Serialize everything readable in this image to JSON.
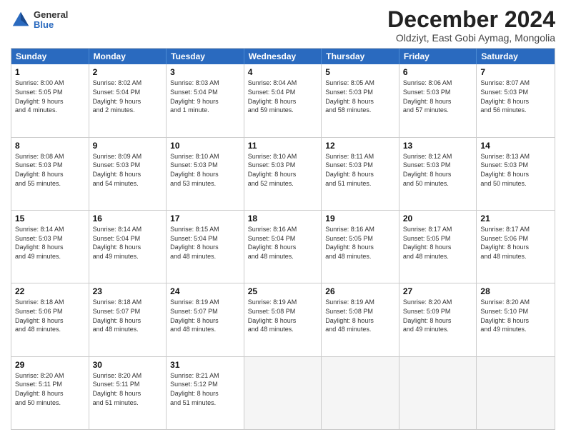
{
  "logo": {
    "general": "General",
    "blue": "Blue"
  },
  "title": "December 2024",
  "subtitle": "Oldziyt, East Gobi Aymag, Mongolia",
  "header_days": [
    "Sunday",
    "Monday",
    "Tuesday",
    "Wednesday",
    "Thursday",
    "Friday",
    "Saturday"
  ],
  "weeks": [
    [
      {
        "day": "1",
        "lines": [
          "Sunrise: 8:00 AM",
          "Sunset: 5:05 PM",
          "Daylight: 9 hours",
          "and 4 minutes."
        ]
      },
      {
        "day": "2",
        "lines": [
          "Sunrise: 8:02 AM",
          "Sunset: 5:04 PM",
          "Daylight: 9 hours",
          "and 2 minutes."
        ]
      },
      {
        "day": "3",
        "lines": [
          "Sunrise: 8:03 AM",
          "Sunset: 5:04 PM",
          "Daylight: 9 hours",
          "and 1 minute."
        ]
      },
      {
        "day": "4",
        "lines": [
          "Sunrise: 8:04 AM",
          "Sunset: 5:04 PM",
          "Daylight: 8 hours",
          "and 59 minutes."
        ]
      },
      {
        "day": "5",
        "lines": [
          "Sunrise: 8:05 AM",
          "Sunset: 5:03 PM",
          "Daylight: 8 hours",
          "and 58 minutes."
        ]
      },
      {
        "day": "6",
        "lines": [
          "Sunrise: 8:06 AM",
          "Sunset: 5:03 PM",
          "Daylight: 8 hours",
          "and 57 minutes."
        ]
      },
      {
        "day": "7",
        "lines": [
          "Sunrise: 8:07 AM",
          "Sunset: 5:03 PM",
          "Daylight: 8 hours",
          "and 56 minutes."
        ]
      }
    ],
    [
      {
        "day": "8",
        "lines": [
          "Sunrise: 8:08 AM",
          "Sunset: 5:03 PM",
          "Daylight: 8 hours",
          "and 55 minutes."
        ]
      },
      {
        "day": "9",
        "lines": [
          "Sunrise: 8:09 AM",
          "Sunset: 5:03 PM",
          "Daylight: 8 hours",
          "and 54 minutes."
        ]
      },
      {
        "day": "10",
        "lines": [
          "Sunrise: 8:10 AM",
          "Sunset: 5:03 PM",
          "Daylight: 8 hours",
          "and 53 minutes."
        ]
      },
      {
        "day": "11",
        "lines": [
          "Sunrise: 8:10 AM",
          "Sunset: 5:03 PM",
          "Daylight: 8 hours",
          "and 52 minutes."
        ]
      },
      {
        "day": "12",
        "lines": [
          "Sunrise: 8:11 AM",
          "Sunset: 5:03 PM",
          "Daylight: 8 hours",
          "and 51 minutes."
        ]
      },
      {
        "day": "13",
        "lines": [
          "Sunrise: 8:12 AM",
          "Sunset: 5:03 PM",
          "Daylight: 8 hours",
          "and 50 minutes."
        ]
      },
      {
        "day": "14",
        "lines": [
          "Sunrise: 8:13 AM",
          "Sunset: 5:03 PM",
          "Daylight: 8 hours",
          "and 50 minutes."
        ]
      }
    ],
    [
      {
        "day": "15",
        "lines": [
          "Sunrise: 8:14 AM",
          "Sunset: 5:03 PM",
          "Daylight: 8 hours",
          "and 49 minutes."
        ]
      },
      {
        "day": "16",
        "lines": [
          "Sunrise: 8:14 AM",
          "Sunset: 5:04 PM",
          "Daylight: 8 hours",
          "and 49 minutes."
        ]
      },
      {
        "day": "17",
        "lines": [
          "Sunrise: 8:15 AM",
          "Sunset: 5:04 PM",
          "Daylight: 8 hours",
          "and 48 minutes."
        ]
      },
      {
        "day": "18",
        "lines": [
          "Sunrise: 8:16 AM",
          "Sunset: 5:04 PM",
          "Daylight: 8 hours",
          "and 48 minutes."
        ]
      },
      {
        "day": "19",
        "lines": [
          "Sunrise: 8:16 AM",
          "Sunset: 5:05 PM",
          "Daylight: 8 hours",
          "and 48 minutes."
        ]
      },
      {
        "day": "20",
        "lines": [
          "Sunrise: 8:17 AM",
          "Sunset: 5:05 PM",
          "Daylight: 8 hours",
          "and 48 minutes."
        ]
      },
      {
        "day": "21",
        "lines": [
          "Sunrise: 8:17 AM",
          "Sunset: 5:06 PM",
          "Daylight: 8 hours",
          "and 48 minutes."
        ]
      }
    ],
    [
      {
        "day": "22",
        "lines": [
          "Sunrise: 8:18 AM",
          "Sunset: 5:06 PM",
          "Daylight: 8 hours",
          "and 48 minutes."
        ]
      },
      {
        "day": "23",
        "lines": [
          "Sunrise: 8:18 AM",
          "Sunset: 5:07 PM",
          "Daylight: 8 hours",
          "and 48 minutes."
        ]
      },
      {
        "day": "24",
        "lines": [
          "Sunrise: 8:19 AM",
          "Sunset: 5:07 PM",
          "Daylight: 8 hours",
          "and 48 minutes."
        ]
      },
      {
        "day": "25",
        "lines": [
          "Sunrise: 8:19 AM",
          "Sunset: 5:08 PM",
          "Daylight: 8 hours",
          "and 48 minutes."
        ]
      },
      {
        "day": "26",
        "lines": [
          "Sunrise: 8:19 AM",
          "Sunset: 5:08 PM",
          "Daylight: 8 hours",
          "and 48 minutes."
        ]
      },
      {
        "day": "27",
        "lines": [
          "Sunrise: 8:20 AM",
          "Sunset: 5:09 PM",
          "Daylight: 8 hours",
          "and 49 minutes."
        ]
      },
      {
        "day": "28",
        "lines": [
          "Sunrise: 8:20 AM",
          "Sunset: 5:10 PM",
          "Daylight: 8 hours",
          "and 49 minutes."
        ]
      }
    ],
    [
      {
        "day": "29",
        "lines": [
          "Sunrise: 8:20 AM",
          "Sunset: 5:11 PM",
          "Daylight: 8 hours",
          "and 50 minutes."
        ]
      },
      {
        "day": "30",
        "lines": [
          "Sunrise: 8:20 AM",
          "Sunset: 5:11 PM",
          "Daylight: 8 hours",
          "and 51 minutes."
        ]
      },
      {
        "day": "31",
        "lines": [
          "Sunrise: 8:21 AM",
          "Sunset: 5:12 PM",
          "Daylight: 8 hours",
          "and 51 minutes."
        ]
      },
      {
        "day": "",
        "lines": []
      },
      {
        "day": "",
        "lines": []
      },
      {
        "day": "",
        "lines": []
      },
      {
        "day": "",
        "lines": []
      }
    ]
  ]
}
